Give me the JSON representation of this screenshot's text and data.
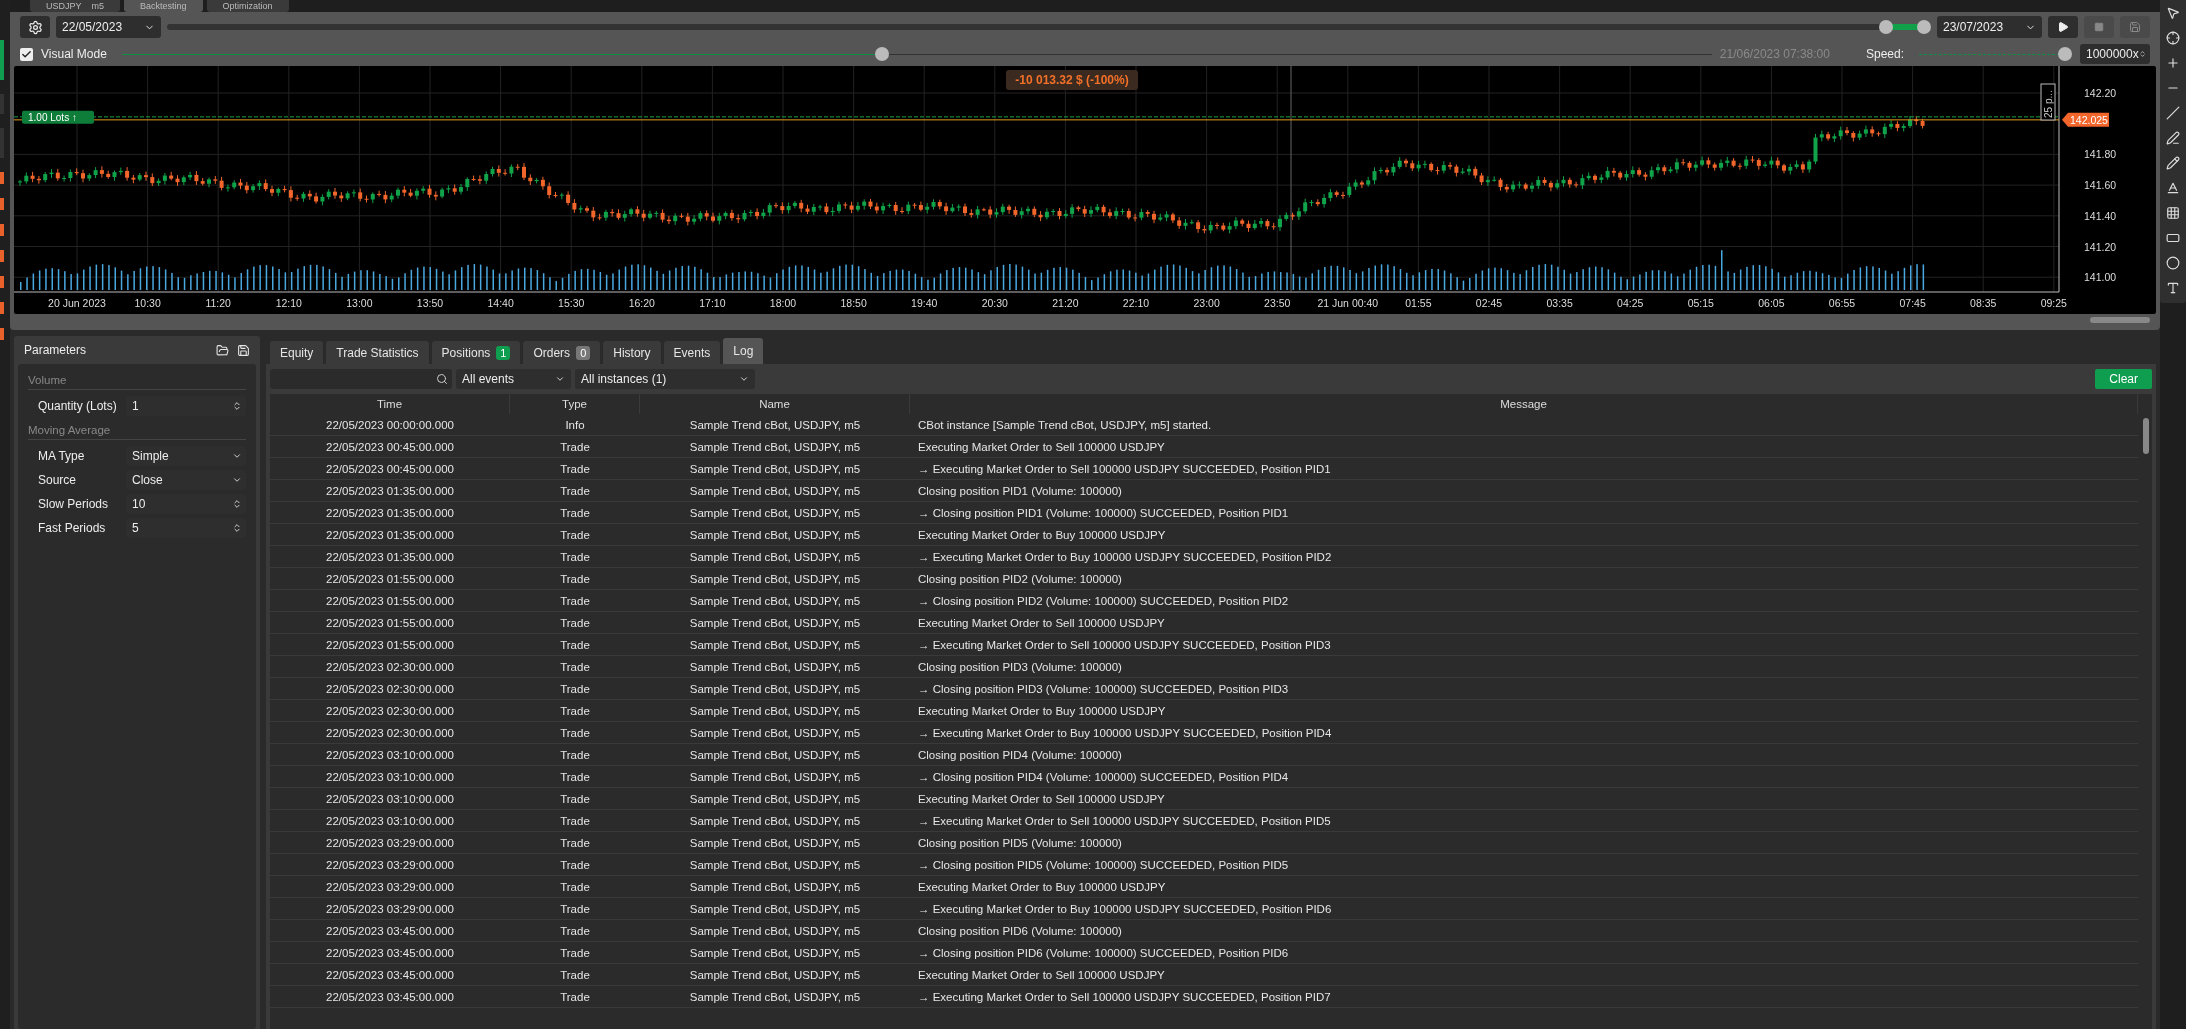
{
  "top_tabs": [
    {
      "label": "USDJPY",
      "timeframe": "m5",
      "selected": false
    },
    {
      "label": "Backtesting",
      "selected": true
    },
    {
      "label": "Optimization",
      "selected": false
    }
  ],
  "toolbar": {
    "start_date": "22/05/2023",
    "range": [
      {
        "level": 0.978
      },
      {
        "level": 1.0
      }
    ],
    "end_date": "23/07/2023",
    "play_disabled": false,
    "stop_disabled": true,
    "save_disabled": true
  },
  "visual_row": {
    "checked": true,
    "label": "Visual Mode",
    "level": 0.48,
    "time": "21/06/2023 07:38:00",
    "speed_label": "Speed:",
    "speed": {
      "level": 1.0
    },
    "speed_value": "1000000x"
  },
  "chart": {
    "pnl": "-10 013.32 $ (-100%)",
    "lots": "1.00 Lots ↑",
    "current_price": "142.025",
    "pips": "25 p...",
    "price_labels": [
      "142.20",
      "141.80",
      "141.60",
      "141.40",
      "141.20",
      "141.00"
    ],
    "time_labels": [
      "20 Jun 2023",
      "10:30",
      "11:20",
      "12:10",
      "13:00",
      "13:50",
      "14:40",
      "15:30",
      "16:20",
      "17:10",
      "18:00",
      "18:50",
      "19:40",
      "20:30",
      "21:20",
      "22:10",
      "23:00",
      "23:50",
      "21 Jun 00:40",
      "01:55",
      "02:45",
      "03:35",
      "04:25",
      "05:15",
      "06:05",
      "06:55",
      "07:45",
      "08:35",
      "09:25"
    ]
  },
  "parameters": {
    "title": "Parameters",
    "groups": [
      {
        "title": "Volume",
        "fields": [
          {
            "label": "Quantity (Lots)",
            "value": "1",
            "kind": "number"
          }
        ]
      },
      {
        "title": "Moving Average",
        "fields": [
          {
            "label": "MA Type",
            "value": "Simple",
            "kind": "select"
          },
          {
            "label": "Source",
            "value": "Close",
            "kind": "select"
          },
          {
            "label": "Slow Periods",
            "value": "10",
            "kind": "number"
          },
          {
            "label": "Fast Periods",
            "value": "5",
            "kind": "number"
          }
        ]
      }
    ]
  },
  "log_tabs": [
    {
      "label": "Equity",
      "selected": false
    },
    {
      "label": "Trade Statistics",
      "selected": false
    },
    {
      "label": "Positions",
      "badge": "1",
      "color": "#0f9d4f",
      "selected": false
    },
    {
      "label": "Orders",
      "badge": "0",
      "color": "#777777",
      "selected": false
    },
    {
      "label": "History",
      "selected": false
    },
    {
      "label": "Events",
      "selected": false
    },
    {
      "label": "Log",
      "selected": true
    }
  ],
  "filters": {
    "events": "All events",
    "instances": "All instances (1)",
    "clear": "Clear"
  },
  "table": {
    "columns": [
      "Time",
      "Type",
      "Name",
      "Message"
    ],
    "rows": [
      [
        "22/05/2023 00:00:00.000",
        "Info",
        "Sample Trend cBot, USDJPY, m5",
        "CBot instance [Sample Trend cBot, USDJPY, m5] started."
      ],
      [
        "22/05/2023 00:45:00.000",
        "Trade",
        "Sample Trend cBot, USDJPY, m5",
        "Executing Market Order to Sell 100000 USDJPY"
      ],
      [
        "22/05/2023 00:45:00.000",
        "Trade",
        "Sample Trend cBot, USDJPY, m5",
        "→ Executing Market Order to Sell 100000 USDJPY SUCCEEDED, Position PID1"
      ],
      [
        "22/05/2023 01:35:00.000",
        "Trade",
        "Sample Trend cBot, USDJPY, m5",
        "Closing position PID1 (Volume: 100000)"
      ],
      [
        "22/05/2023 01:35:00.000",
        "Trade",
        "Sample Trend cBot, USDJPY, m5",
        "→ Closing position PID1 (Volume: 100000) SUCCEEDED, Position PID1"
      ],
      [
        "22/05/2023 01:35:00.000",
        "Trade",
        "Sample Trend cBot, USDJPY, m5",
        "Executing Market Order to Buy 100000 USDJPY"
      ],
      [
        "22/05/2023 01:35:00.000",
        "Trade",
        "Sample Trend cBot, USDJPY, m5",
        "→ Executing Market Order to Buy 100000 USDJPY SUCCEEDED, Position PID2"
      ],
      [
        "22/05/2023 01:55:00.000",
        "Trade",
        "Sample Trend cBot, USDJPY, m5",
        "Closing position PID2 (Volume: 100000)"
      ],
      [
        "22/05/2023 01:55:00.000",
        "Trade",
        "Sample Trend cBot, USDJPY, m5",
        "→ Closing position PID2 (Volume: 100000) SUCCEEDED, Position PID2"
      ],
      [
        "22/05/2023 01:55:00.000",
        "Trade",
        "Sample Trend cBot, USDJPY, m5",
        "Executing Market Order to Sell 100000 USDJPY"
      ],
      [
        "22/05/2023 01:55:00.000",
        "Trade",
        "Sample Trend cBot, USDJPY, m5",
        "→ Executing Market Order to Sell 100000 USDJPY SUCCEEDED, Position PID3"
      ],
      [
        "22/05/2023 02:30:00.000",
        "Trade",
        "Sample Trend cBot, USDJPY, m5",
        "Closing position PID3 (Volume: 100000)"
      ],
      [
        "22/05/2023 02:30:00.000",
        "Trade",
        "Sample Trend cBot, USDJPY, m5",
        "→ Closing position PID3 (Volume: 100000) SUCCEEDED, Position PID3"
      ],
      [
        "22/05/2023 02:30:00.000",
        "Trade",
        "Sample Trend cBot, USDJPY, m5",
        "Executing Market Order to Buy 100000 USDJPY"
      ],
      [
        "22/05/2023 02:30:00.000",
        "Trade",
        "Sample Trend cBot, USDJPY, m5",
        "→ Executing Market Order to Buy 100000 USDJPY SUCCEEDED, Position PID4"
      ],
      [
        "22/05/2023 03:10:00.000",
        "Trade",
        "Sample Trend cBot, USDJPY, m5",
        "Closing position PID4 (Volume: 100000)"
      ],
      [
        "22/05/2023 03:10:00.000",
        "Trade",
        "Sample Trend cBot, USDJPY, m5",
        "→ Closing position PID4 (Volume: 100000) SUCCEEDED, Position PID4"
      ],
      [
        "22/05/2023 03:10:00.000",
        "Trade",
        "Sample Trend cBot, USDJPY, m5",
        "Executing Market Order to Sell 100000 USDJPY"
      ],
      [
        "22/05/2023 03:10:00.000",
        "Trade",
        "Sample Trend cBot, USDJPY, m5",
        "→ Executing Market Order to Sell 100000 USDJPY SUCCEEDED, Position PID5"
      ],
      [
        "22/05/2023 03:29:00.000",
        "Trade",
        "Sample Trend cBot, USDJPY, m5",
        "Closing position PID5 (Volume: 100000)"
      ],
      [
        "22/05/2023 03:29:00.000",
        "Trade",
        "Sample Trend cBot, USDJPY, m5",
        "→ Closing position PID5 (Volume: 100000) SUCCEEDED, Position PID5"
      ],
      [
        "22/05/2023 03:29:00.000",
        "Trade",
        "Sample Trend cBot, USDJPY, m5",
        "Executing Market Order to Buy 100000 USDJPY"
      ],
      [
        "22/05/2023 03:29:00.000",
        "Trade",
        "Sample Trend cBot, USDJPY, m5",
        "→ Executing Market Order to Buy 100000 USDJPY SUCCEEDED, Position PID6"
      ],
      [
        "22/05/2023 03:45:00.000",
        "Trade",
        "Sample Trend cBot, USDJPY, m5",
        "Closing position PID6 (Volume: 100000)"
      ],
      [
        "22/05/2023 03:45:00.000",
        "Trade",
        "Sample Trend cBot, USDJPY, m5",
        "→ Closing position PID6 (Volume: 100000) SUCCEEDED, Position PID6"
      ],
      [
        "22/05/2023 03:45:00.000",
        "Trade",
        "Sample Trend cBot, USDJPY, m5",
        "Executing Market Order to Sell 100000 USDJPY"
      ],
      [
        "22/05/2023 03:45:00.000",
        "Trade",
        "Sample Trend cBot, USDJPY, m5",
        "→ Executing Market Order to Sell 100000 USDJPY SUCCEEDED, Position PID7"
      ]
    ]
  }
}
